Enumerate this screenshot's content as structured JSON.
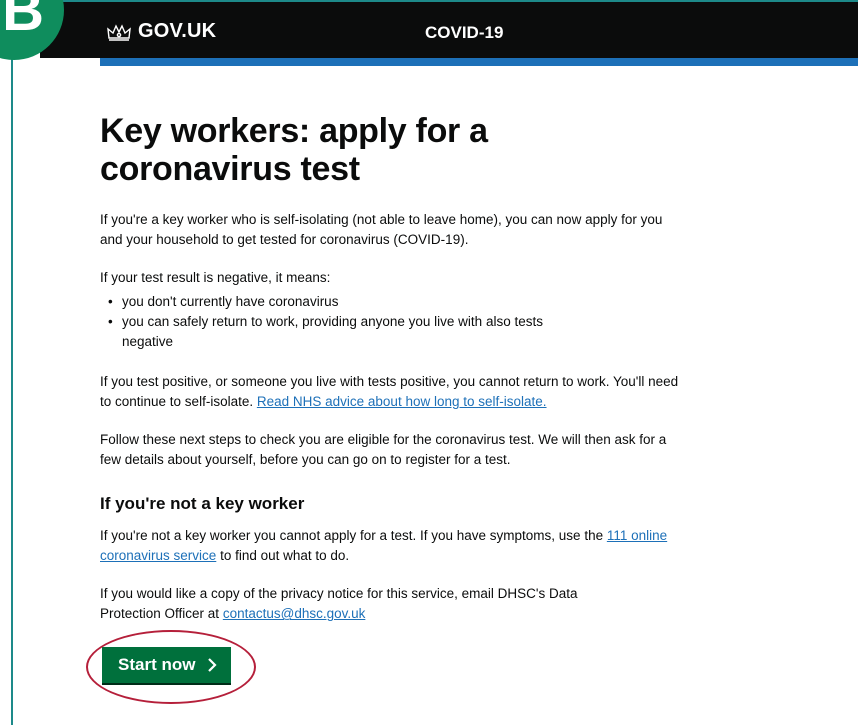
{
  "badge": "B",
  "header": {
    "logo_text": "GOV.UK",
    "service_name": "COVID-19"
  },
  "main": {
    "title": "Key workers: apply for a coronavirus test",
    "intro": "If you're a key worker who is self-isolating (not able to leave home), you can now apply for you and your household to get tested for coronavirus (COVID-19).",
    "negative_lead": "If your test result is negative, it means:",
    "negative_items": [
      "you don't currently have coronavirus",
      "you can safely return to work, providing anyone you live with also tests negative"
    ],
    "positive_text": "If you test positive, or someone you live with tests positive, you cannot return to work. You'll need to continue to self-isolate.",
    "positive_link": "Read NHS advice about how long to self-isolate.",
    "next_steps": "Follow these next steps to check you are eligible for the coronavirus test. We will then ask for a few details about yourself, before you can go on to register for a test.",
    "not_key_heading": "If you're not a key worker",
    "not_key_text_before": "If you're not a key worker you cannot apply for a test. If you have symptoms, use the",
    "not_key_link": "111 online coronavirus service",
    "not_key_text_after": "to find out what to do.",
    "privacy_text": "If you would like a copy of the privacy notice for this service, email DHSC's Data Protection Officer at",
    "privacy_email": "contactus@dhsc.gov.uk",
    "start_button": "Start now"
  },
  "colors": {
    "header_bg": "#0b0c0c",
    "stripe": "#1d70b8",
    "button": "#00703c",
    "link": "#1d70b8",
    "badge": "#0f8d5d",
    "highlight": "#b51f3a"
  }
}
